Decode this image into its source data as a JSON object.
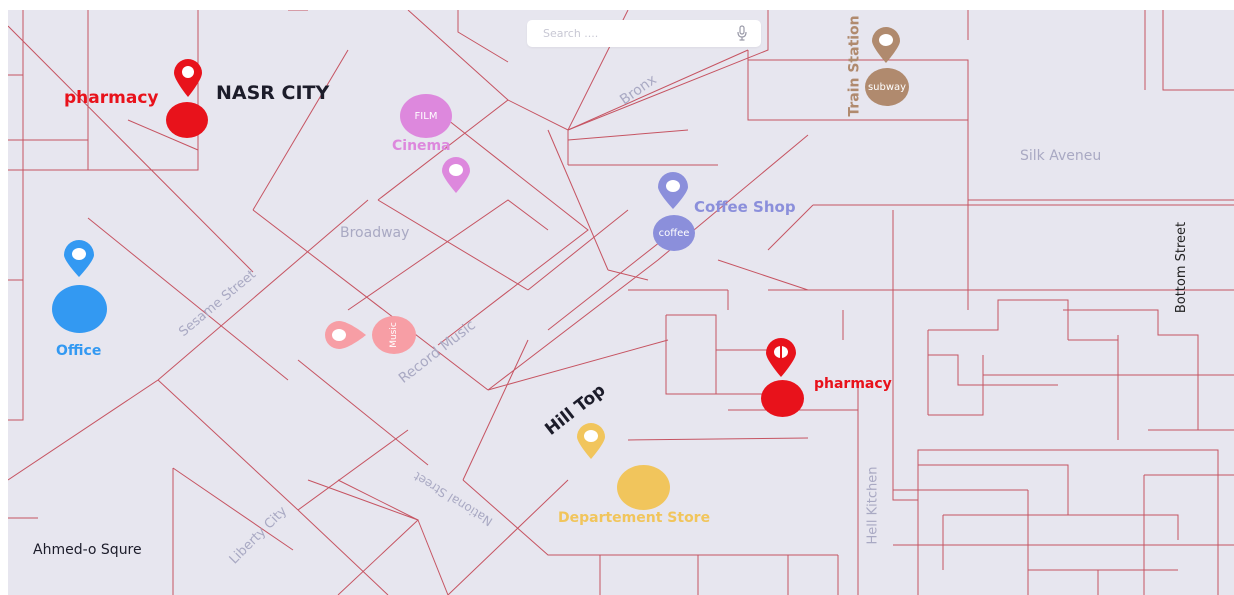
{
  "search": {
    "placeholder": "Search ....",
    "mic_icon": "microphone-icon"
  },
  "areas": {
    "nasr_city": "NASR CITY",
    "hill_top": "Hill Top",
    "ahmed_square": "Ahmed-o Squre"
  },
  "streets": {
    "bronx": "Bronx",
    "broadway": "Broadway",
    "sesame": "Sesame Street",
    "record_music": "Record Music",
    "national": "National Street",
    "liberty": "Liberty City",
    "hell_kitchen": "Hell Kitchen",
    "silk": "Silk Aveneu",
    "bottom": "Bottom Street",
    "train_station": "Train Station"
  },
  "pois": {
    "pharmacy_nw": {
      "label": "pharmacy",
      "color": "#e8121b"
    },
    "pharmacy_se": {
      "label": "pharmacy",
      "color": "#e8121b"
    },
    "cinema": {
      "label": "Cinema",
      "badge": "FILM",
      "color": "#dd88dd"
    },
    "coffee": {
      "label": "Coffee Shop",
      "badge": "coffee",
      "color": "#8b8fdb"
    },
    "subway": {
      "badge": "subway",
      "color": "#b08a6e"
    },
    "office": {
      "label": "Office",
      "color": "#3399f2"
    },
    "music": {
      "badge": "Music",
      "color": "#f79ea5"
    },
    "department": {
      "label": "Departement Store",
      "color": "#f1c55c"
    }
  }
}
